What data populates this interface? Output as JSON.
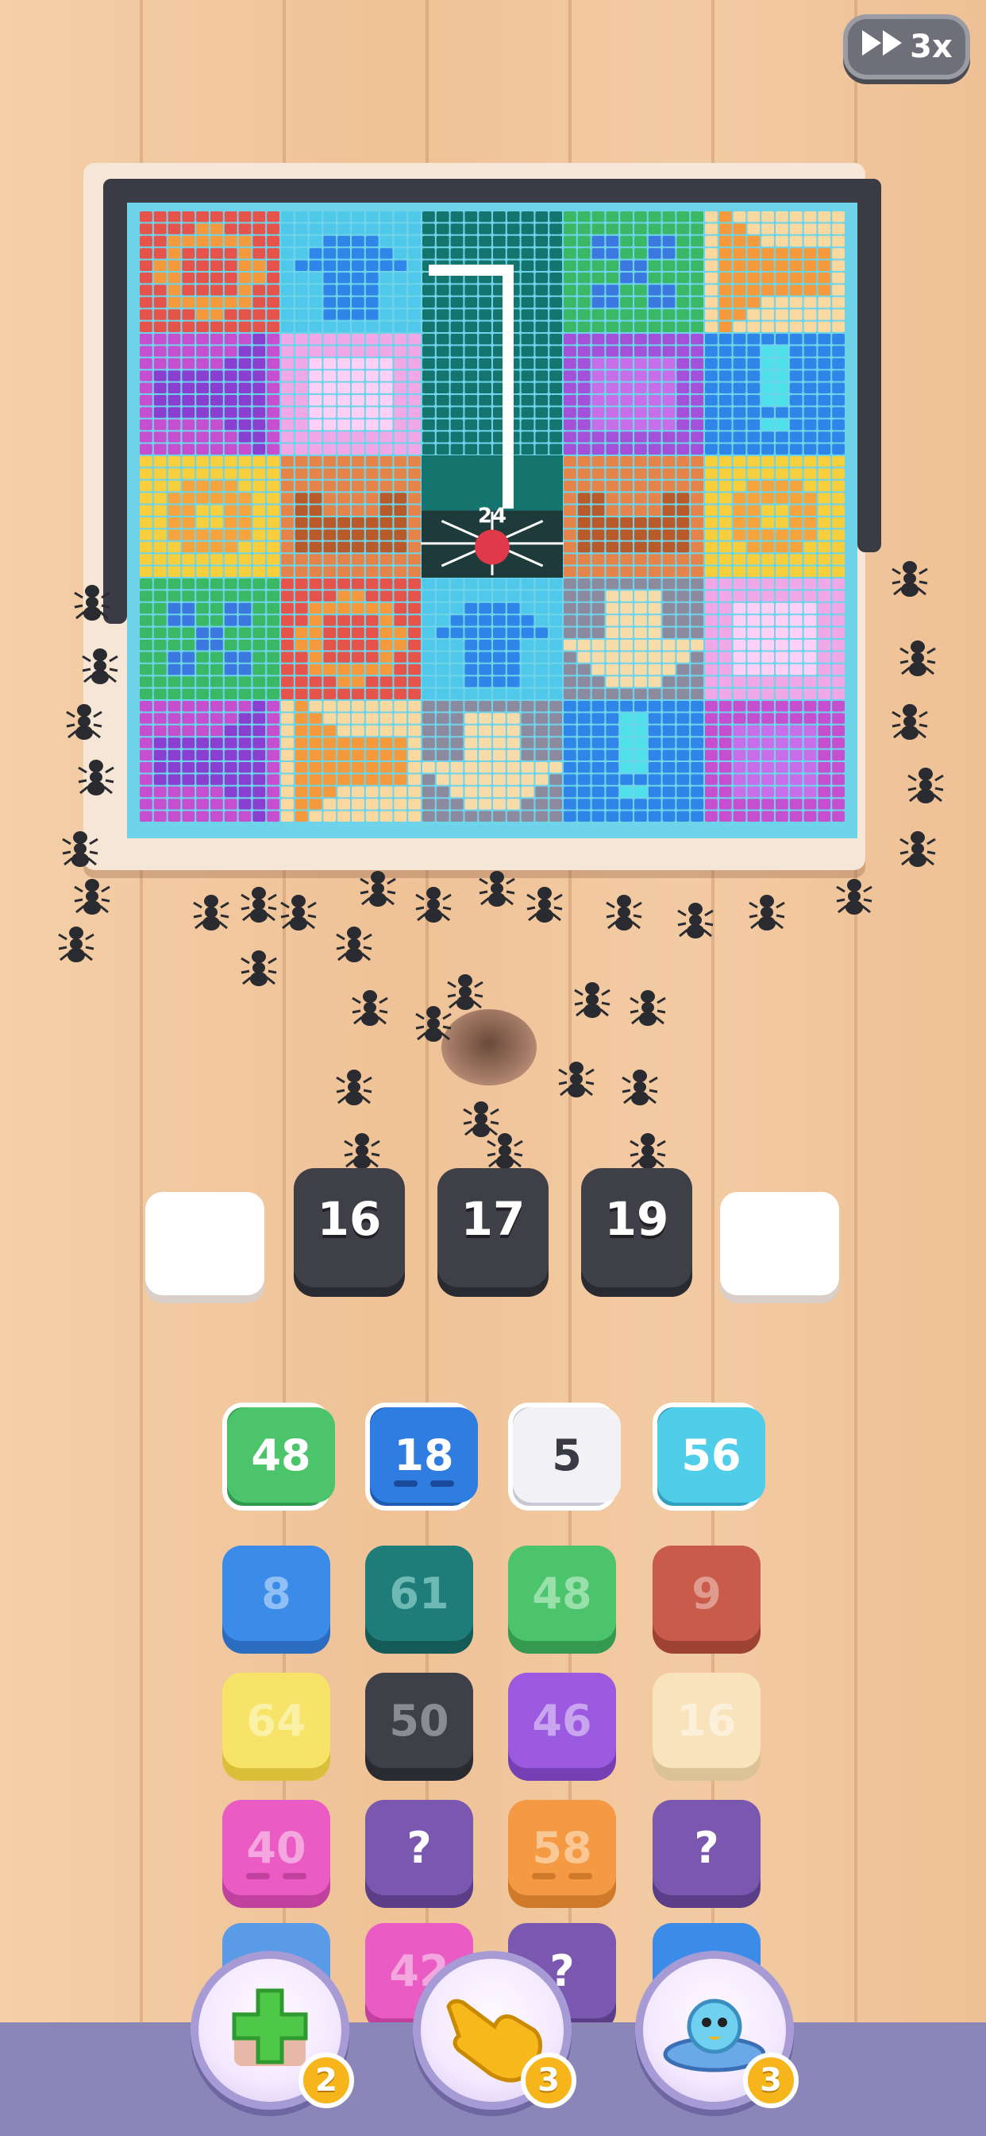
{
  "speed_button": {
    "label": "3x",
    "icon": "fast-forward-icon"
  },
  "board": {
    "cells": [
      {
        "color": "#e5534b",
        "pattern": "ring-orange"
      },
      {
        "color": "#4fc8ea",
        "pattern": "arrow-up-blue"
      },
      {
        "color": "#14756f",
        "pattern": "teal-column"
      },
      {
        "color": "#3bb865",
        "pattern": "dots-blue"
      },
      {
        "color": "#f9d9a0",
        "pattern": "arrow-left-orange"
      },
      {
        "color": "#c64fcf",
        "pattern": "arrow-right-purple"
      },
      {
        "color": "#f0a8e6",
        "pattern": "square-pink"
      },
      {
        "color": "#14756f",
        "pattern": "teal-column"
      },
      {
        "color": "#a450d8",
        "pattern": "square-purple"
      },
      {
        "color": "#2f86e8",
        "pattern": "exclaim-cyan"
      },
      {
        "color": "#f7cf3c",
        "pattern": "flower-orange"
      },
      {
        "color": "#e5844a",
        "pattern": "bowl-brown"
      },
      {
        "color": "#1f3a3a",
        "pattern": "spider-web"
      },
      {
        "color": "#e5844a",
        "pattern": "bowl-brown"
      },
      {
        "color": "#f7cf3c",
        "pattern": "flower-orange"
      },
      {
        "color": "#3bb865",
        "pattern": "dots-blue"
      },
      {
        "color": "#e5534b",
        "pattern": "ring-orange"
      },
      {
        "color": "#4fc8ea",
        "pattern": "arrow-up-blue"
      },
      {
        "color": "#8c8a9e",
        "pattern": "arrow-down-cream"
      },
      {
        "color": "#f0a8e6",
        "pattern": "square-pink"
      },
      {
        "color": "#c64fcf",
        "pattern": "arrow-right-purple"
      },
      {
        "color": "#f9d9a0",
        "pattern": "arrow-left-orange"
      },
      {
        "color": "#8c8a9e",
        "pattern": "arrow-down-cream"
      },
      {
        "color": "#2f86e8",
        "pattern": "exclaim-cyan"
      },
      {
        "color": "#c64fcf",
        "pattern": "square-purple"
      }
    ],
    "spider_count": "24"
  },
  "queue": {
    "slots": [
      "empty",
      "16",
      "17",
      "19",
      "empty"
    ]
  },
  "tiles": [
    {
      "label": "48",
      "color": "#4cc46b",
      "shade": "#2f9a4d",
      "text": "#ffffff",
      "active": true,
      "bars": false
    },
    {
      "label": "18",
      "color": "#2f7de0",
      "shade": "#1f5db5",
      "text": "#ffffff",
      "active": true,
      "bars": true,
      "bar_color": "#1a4a99"
    },
    {
      "label": "5",
      "color": "#f2f2f6",
      "shade": "#c8c8d3",
      "text": "#3a3a44",
      "active": true,
      "bars": false
    },
    {
      "label": "56",
      "color": "#4fcde9",
      "shade": "#2fa0c0",
      "text": "#ffffff",
      "active": true,
      "bars": false
    },
    {
      "label": "8",
      "color": "#3b8ce8",
      "shade": "#2a6cc0",
      "text": "#8fbff5",
      "active": false,
      "bars": false
    },
    {
      "label": "61",
      "color": "#1e7d79",
      "shade": "#145b58",
      "text": "#6fb9b4",
      "active": false,
      "bars": false
    },
    {
      "label": "48",
      "color": "#4cc46b",
      "shade": "#349a50",
      "text": "#9ae0ab",
      "active": false,
      "bars": false
    },
    {
      "label": "9",
      "color": "#c95b4b",
      "shade": "#9e4236",
      "text": "#e09a8e",
      "active": false,
      "bars": false
    },
    {
      "label": "64",
      "color": "#f7e368",
      "shade": "#d9bf3a",
      "text": "#faf0a6",
      "active": false,
      "bars": false
    },
    {
      "label": "50",
      "color": "#3e3f47",
      "shade": "#2a2b31",
      "text": "#8a8b93",
      "active": false,
      "bars": false
    },
    {
      "label": "46",
      "color": "#9b5ae0",
      "shade": "#7440b4",
      "text": "#c9a4ef",
      "active": false,
      "bars": false
    },
    {
      "label": "16",
      "color": "#f8e3bd",
      "shade": "#dcc396",
      "text": "#fbf0da",
      "active": false,
      "bars": false
    },
    {
      "label": "40",
      "color": "#ea5cc4",
      "shade": "#c0429e",
      "text": "#f4a6df",
      "active": false,
      "bars": true,
      "bar_color": "#c0429e"
    },
    {
      "label": "?",
      "color": "#7a58b0",
      "shade": "#5a3f88",
      "text": "#ffffff",
      "active": false,
      "bars": false,
      "mystery": true
    },
    {
      "label": "58",
      "color": "#f49a45",
      "shade": "#cf7a2a",
      "text": "#f9c894",
      "active": false,
      "bars": true,
      "bar_color": "#cf7a2a"
    },
    {
      "label": "?",
      "color": "#7a58b0",
      "shade": "#5a3f88",
      "text": "#ffffff",
      "active": false,
      "bars": false,
      "mystery": true
    },
    {
      "label": "",
      "color": "#5a9be8",
      "shade": "#3e7cc8",
      "text": "#ffffff",
      "active": false,
      "bars": false
    },
    {
      "label": "42",
      "color": "#ea5cc4",
      "shade": "#c0429e",
      "text": "#f4a6df",
      "active": false,
      "bars": false
    },
    {
      "label": "?",
      "color": "#7a58b0",
      "shade": "#5a3f88",
      "text": "#ffffff",
      "active": false,
      "bars": false,
      "mystery": true
    },
    {
      "label": "",
      "color": "#3b8ce8",
      "shade": "#2a6cc0",
      "text": "#ffffff",
      "active": false,
      "bars": false
    }
  ],
  "powerups": [
    {
      "name": "add-tile",
      "icon": "plus-icon",
      "count": "2"
    },
    {
      "name": "hand",
      "icon": "pointing-hand-icon",
      "count": "3"
    },
    {
      "name": "ufo",
      "icon": "ufo-icon",
      "count": "3"
    }
  ]
}
